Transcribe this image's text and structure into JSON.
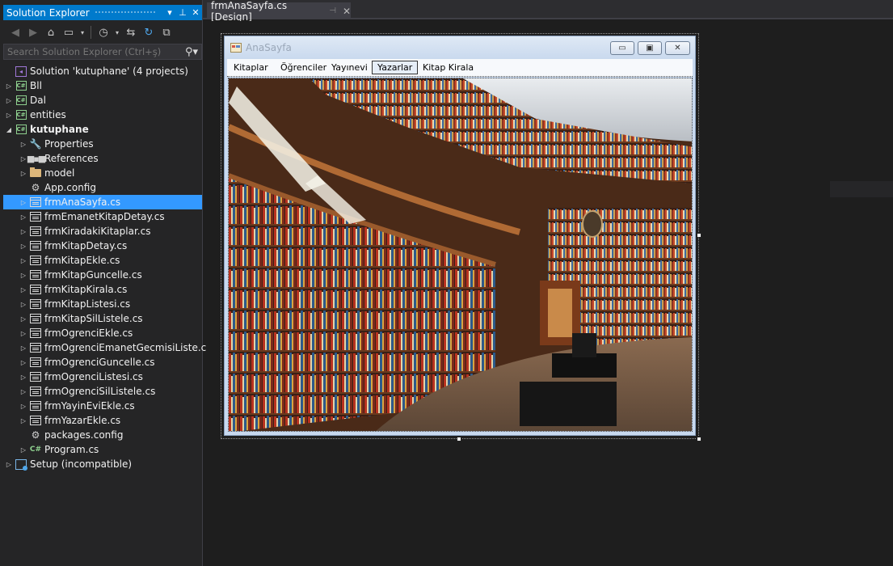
{
  "solution_explorer": {
    "title": "Solution Explorer",
    "search_placeholder": "Search Solution Explorer (Ctrl+ş)",
    "solution_label": "Solution 'kutuphane' (4 projects)",
    "projects": [
      {
        "label": "Bll",
        "icon": "csharp-project-icon"
      },
      {
        "label": "Dal",
        "icon": "csharp-project-icon"
      },
      {
        "label": "entities",
        "icon": "csharp-project-icon"
      }
    ],
    "main_project": {
      "label": "kutuphane",
      "children": [
        {
          "label": "Properties",
          "icon": "wrench-icon",
          "expandable": true
        },
        {
          "label": "References",
          "icon": "references-icon",
          "expandable": true
        },
        {
          "label": "model",
          "icon": "folder-icon",
          "expandable": true
        },
        {
          "label": "App.config",
          "icon": "config-file-icon",
          "expandable": false
        },
        {
          "label": "frmAnaSayfa.cs",
          "icon": "form-icon",
          "expandable": true,
          "selected": true
        },
        {
          "label": "frmEmanetKitapDetay.cs",
          "icon": "form-icon",
          "expandable": true
        },
        {
          "label": "frmKiradakiKitaplar.cs",
          "icon": "form-icon",
          "expandable": true
        },
        {
          "label": "frmKitapDetay.cs",
          "icon": "form-icon",
          "expandable": true
        },
        {
          "label": "frmKitapEkle.cs",
          "icon": "form-icon",
          "expandable": true
        },
        {
          "label": "frmKitapGuncelle.cs",
          "icon": "form-icon",
          "expandable": true
        },
        {
          "label": "frmKitapKirala.cs",
          "icon": "form-icon",
          "expandable": true
        },
        {
          "label": "frmKitapListesi.cs",
          "icon": "form-icon",
          "expandable": true
        },
        {
          "label": "frmKitapSilListele.cs",
          "icon": "form-icon",
          "expandable": true
        },
        {
          "label": "frmOgrenciEkle.cs",
          "icon": "form-icon",
          "expandable": true
        },
        {
          "label": "frmOgrenciEmanetGecmisiListe.c",
          "icon": "form-icon",
          "expandable": true
        },
        {
          "label": "frmOgrenciGuncelle.cs",
          "icon": "form-icon",
          "expandable": true
        },
        {
          "label": "frmOgrenciListesi.cs",
          "icon": "form-icon",
          "expandable": true
        },
        {
          "label": "frmOgrenciSilListele.cs",
          "icon": "form-icon",
          "expandable": true
        },
        {
          "label": "frmYayinEviEkle.cs",
          "icon": "form-icon",
          "expandable": true
        },
        {
          "label": "frmYazarEkle.cs",
          "icon": "form-icon",
          "expandable": true
        },
        {
          "label": "packages.config",
          "icon": "config-file-icon",
          "expandable": false
        },
        {
          "label": "Program.cs",
          "icon": "csharp-file-icon",
          "expandable": true
        }
      ]
    },
    "setup_label": "Setup (incompatible)"
  },
  "document_tab": {
    "label": "frmAnaSayfa.cs [Design]"
  },
  "form": {
    "title": "AnaSayfa",
    "menu": [
      "Kitaplar",
      "Öğrenciler",
      "Yayınevi",
      "Yazarlar",
      "Kitap Kirala"
    ],
    "selected_menu_index": 3
  },
  "colors": {
    "accent": "#007acc",
    "selection": "#3399ff",
    "background": "#1e1e1e",
    "panel": "#252526"
  }
}
